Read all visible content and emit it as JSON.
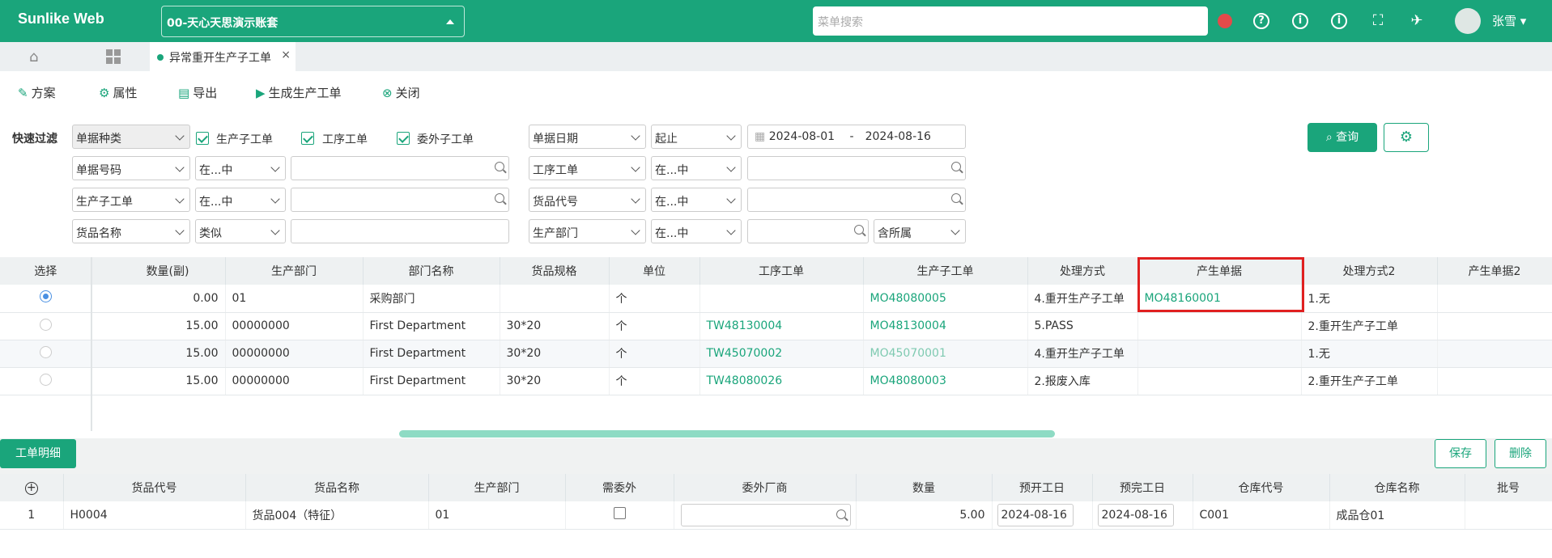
{
  "brand": "Sunlike Web",
  "account": "00-天心天思演示账套",
  "menu_search_placeholder": "菜单搜索",
  "user": "张雪",
  "tab": "异常重开生产子工单",
  "toolbar": {
    "scheme": "方案",
    "props": "属性",
    "export": "导出",
    "gen": "生成生产工单",
    "close": "关闭"
  },
  "filter": {
    "quick": "快速过滤",
    "doc_kind": "单据种类",
    "cb1": "生产子工单",
    "cb2": "工序工单",
    "cb3": "委外子工单",
    "doc_date": "单据日期",
    "range": "起止",
    "date_from": "2024-08-01",
    "date_sep": "-",
    "date_to": "2024-08-16",
    "r2a": "单据号码",
    "r2b": "在...中",
    "r2c": "工序工单",
    "r2d": "在...中",
    "r3a": "生产子工单",
    "r3b": "在...中",
    "r3c": "货品代号",
    "r3d": "在...中",
    "r4a": "货品名称",
    "r4b": "类似",
    "r4c": "生产部门",
    "r4d": "在...中",
    "r4e": "含所属",
    "query": "查询"
  },
  "grid": {
    "headers": [
      "选择",
      "数量(副)",
      "生产部门",
      "部门名称",
      "货品规格",
      "单位",
      "工序工单",
      "生产子工单",
      "处理方式",
      "产生单据",
      "处理方式2",
      "产生单据2"
    ],
    "rows": [
      {
        "qty": "0.00",
        "dept": "01",
        "dname": "采购部门",
        "spec": "",
        "unit": "个",
        "op": "",
        "mo": "MO48080005",
        "mode": "4.重开生产子工单",
        "gen": "MO48160001",
        "mode2": "1.无"
      },
      {
        "qty": "15.00",
        "dept": "00000000",
        "dname": "First Department",
        "spec": "30*20",
        "unit": "个",
        "op": "TW48130004",
        "mo": "MO48130004",
        "mode": "5.PASS",
        "gen": "",
        "mode2": "2.重开生产子工单"
      },
      {
        "qty": "15.00",
        "dept": "00000000",
        "dname": "First Department",
        "spec": "30*20",
        "unit": "个",
        "op": "TW45070002",
        "mo": "MO45070001",
        "mode": "4.重开生产子工单",
        "gen": "",
        "mode2": "1.无"
      },
      {
        "qty": "15.00",
        "dept": "00000000",
        "dname": "First Department",
        "spec": "30*20",
        "unit": "个",
        "op": "TW48080026",
        "mo": "MO48080003",
        "mode": "2.报废入库",
        "gen": "",
        "mode2": "2.重开生产子工单"
      }
    ]
  },
  "detail": {
    "tab": "工单明细",
    "save": "保存",
    "del": "删除",
    "headers": [
      "货品代号",
      "货品名称",
      "生产部门",
      "需委外",
      "委外厂商",
      "数量",
      "预开工日",
      "预完工日",
      "仓库代号",
      "仓库名称",
      "批号"
    ],
    "row": {
      "no": "1",
      "code": "H0004",
      "name": "货品004（特征）",
      "dept": "01",
      "qty": "5.00",
      "start": "2024-08-16",
      "end": "2024-08-16",
      "wh": "C001",
      "whname": "成品仓01"
    }
  }
}
